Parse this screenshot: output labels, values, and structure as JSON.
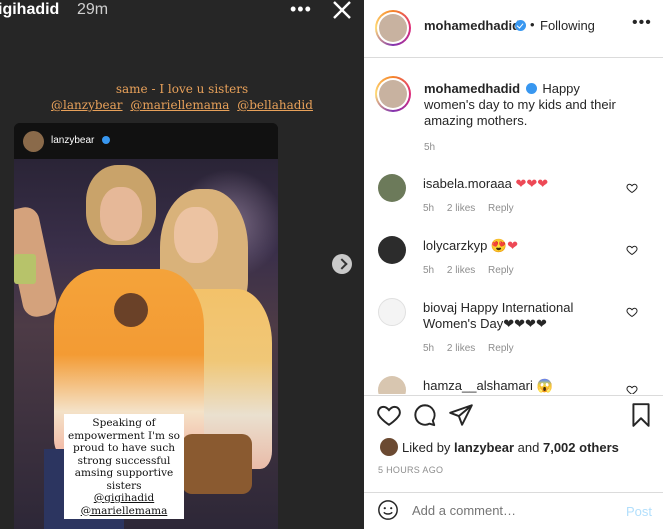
{
  "story": {
    "username": "igihadid",
    "time": "29m",
    "caption_line1": "same - I love u sisters",
    "mentions": [
      "@lanzybear",
      "@mariellemama",
      "@bellahadid"
    ],
    "repost_username": "lanzybear",
    "photo_overlay_lines": [
      "Speaking of",
      "empowerment I'm so",
      "proud to have such",
      "strong successful",
      "amsing supportive",
      "sisters"
    ],
    "photo_overlay_mentions": [
      "@gigihadid",
      "@mariellemama"
    ]
  },
  "post": {
    "author": "mohamedhadid",
    "follow_status": "Following",
    "caption_author": "mohamedhadid",
    "caption_text": "Happy women's day to my kids and their amazing mothers.",
    "caption_time": "5h",
    "comments": [
      {
        "user": "isabela.moraaa",
        "text": "❤❤❤",
        "time": "5h",
        "likes": "2 likes",
        "reply": "Reply"
      },
      {
        "user": "lolycarzkyp",
        "text": "😍❤",
        "time": "5h",
        "likes": "2 likes",
        "reply": "Reply"
      },
      {
        "user": "biovaj",
        "text": "Happy International Women's Day❤❤❤❤",
        "time": "5h",
        "likes": "2 likes",
        "reply": "Reply"
      },
      {
        "user": "hamza__alshamari",
        "text": "😱",
        "time": "",
        "likes": "",
        "reply": ""
      }
    ],
    "liked_by_prefix": "Liked by",
    "liked_by_user": "lanzybear",
    "liked_by_and": "and",
    "liked_by_others": "7,002 others",
    "time_ago": "5 HOURS AGO",
    "add_comment_placeholder": "Add a comment…",
    "post_button": "Post"
  },
  "colors": {
    "verified": "#3897f0",
    "story_caption": "#e8a15a",
    "heart": "#ed4956"
  },
  "icons": [
    "more-icon",
    "close-icon",
    "next-arrow-icon",
    "verified-icon",
    "heart-icon",
    "comment-icon",
    "share-icon",
    "bookmark-icon",
    "emoji-icon"
  ]
}
